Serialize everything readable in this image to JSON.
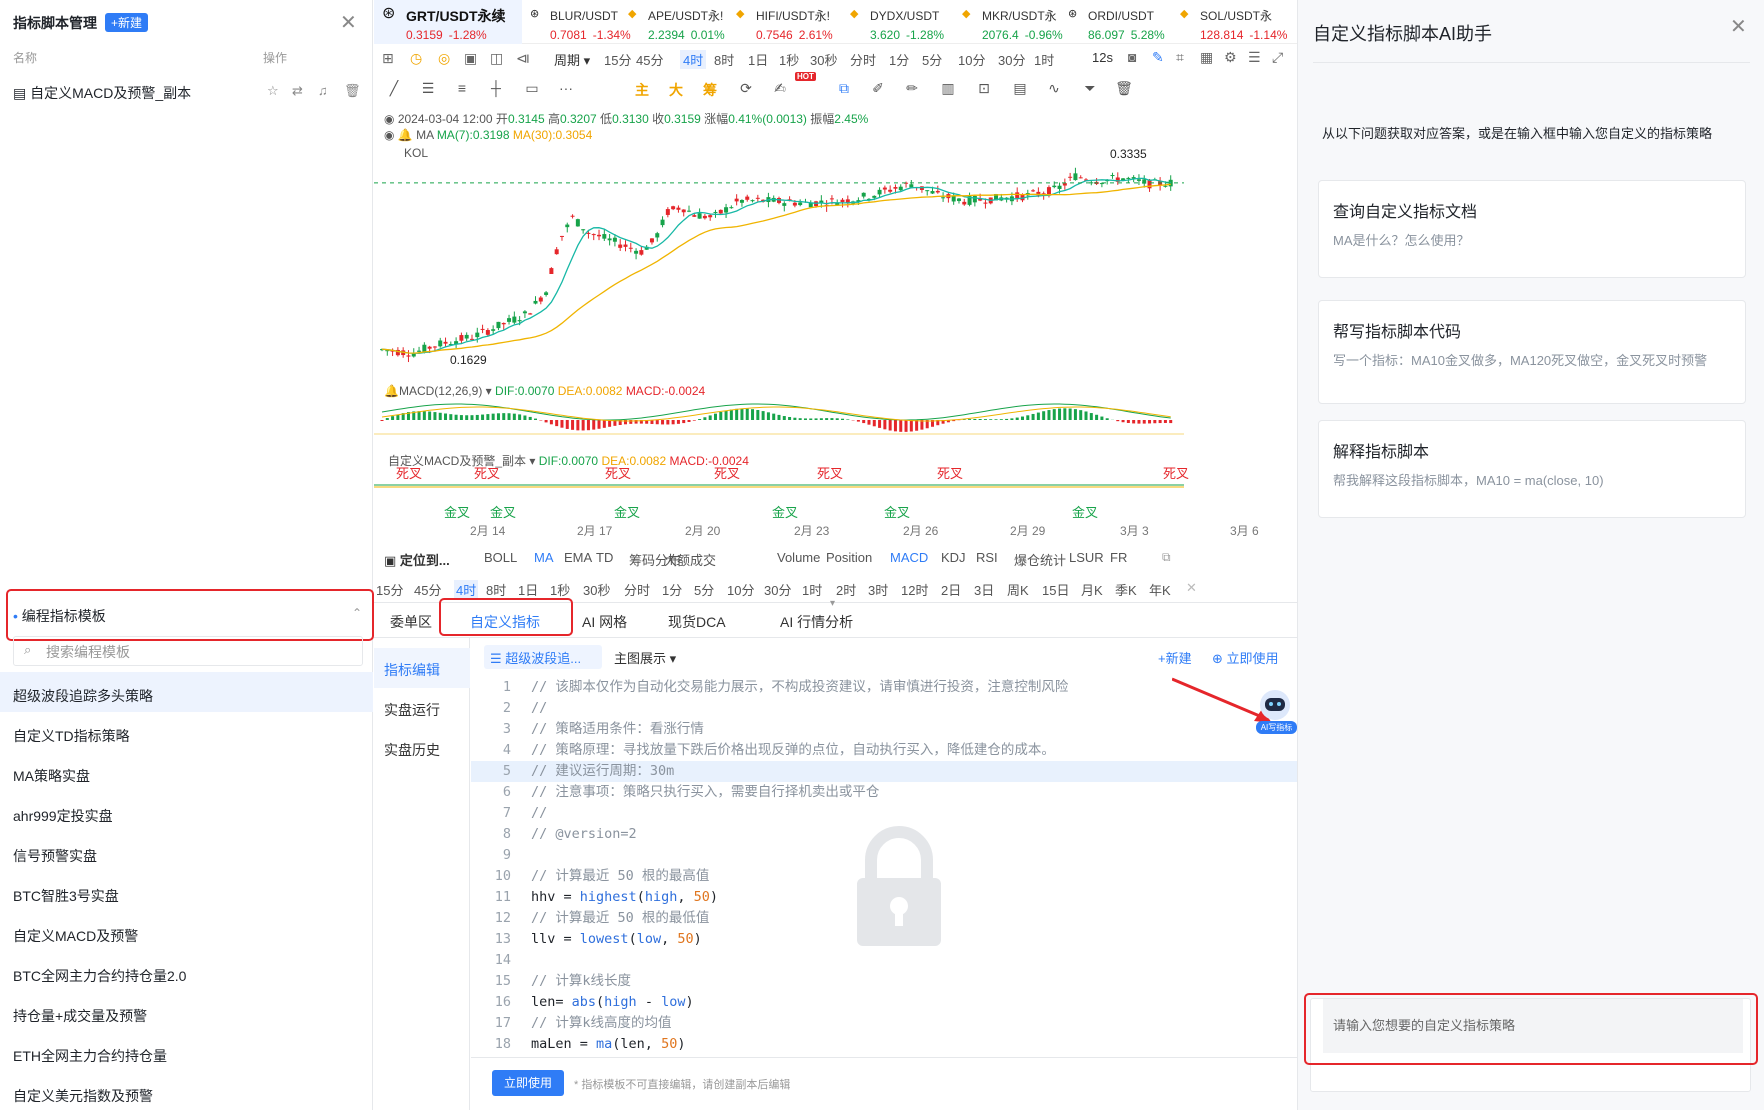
{
  "left": {
    "title": "指标脚本管理",
    "new_btn": "+新建",
    "col_name": "名称",
    "col_ops": "操作",
    "my_item": "自定义MACD及预警_副本",
    "tpl_section": "编程指标模板",
    "search_placeholder": "搜索编程模板",
    "templates": [
      "超级波段追踪多头策略",
      "自定义TD指标策略",
      "MA策略实盘",
      "ahr999定投实盘",
      "信号预警实盘",
      "BTC智胜3号实盘",
      "自定义MACD及预警",
      "BTC全网主力合约持仓量2.0",
      "持仓量+成交量及预警",
      "ETH全网主力合约持仓量",
      "自定义美元指数及预警"
    ]
  },
  "symbols": [
    {
      "name": "GRT/USDT永续",
      "price": "0.3159",
      "chg": "-1.28%",
      "dir": "down"
    },
    {
      "name": "BLUR/USDT",
      "price": "0.7081",
      "chg": "-1.34%",
      "dir": "down"
    },
    {
      "name": "APE/USDT永!",
      "price": "2.2394",
      "chg": "0.01%",
      "dir": "up"
    },
    {
      "name": "HIFI/USDT永!",
      "price": "0.7546",
      "chg": "2.61%",
      "dir": "down"
    },
    {
      "name": "DYDX/USDT",
      "price": "3.620",
      "chg": "-1.28%",
      "dir": "up"
    },
    {
      "name": "MKR/USDT永",
      "price": "2076.4",
      "chg": "-0.96%",
      "dir": "up"
    },
    {
      "name": "ORDI/USDT",
      "price": "86.097",
      "chg": "5.28%",
      "dir": "up"
    },
    {
      "name": "SOL/USDT永",
      "price": "128.814",
      "chg": "-1.14%",
      "dir": "down"
    }
  ],
  "toolbar": {
    "period_label": "周期",
    "timeframes": [
      "15分",
      "45分",
      "4时",
      "8时",
      "1日",
      "1秒",
      "30秒",
      "分时",
      "1分",
      "5分",
      "10分",
      "30分",
      "1时"
    ],
    "active_tf": "4时",
    "right_label": "12s",
    "draw_labels": [
      "主",
      "大",
      "筹"
    ],
    "hot": "HOT"
  },
  "chart": {
    "ohlc_line": "2024-03-04 12:00",
    "open_l": "开",
    "open": "0.3145",
    "high_l": "高",
    "high": "0.3207",
    "low_l": "低",
    "low": "0.3130",
    "close_l": "收",
    "close": "0.3159",
    "chg_l": "涨幅",
    "chg": "0.41%(0.0013)",
    "amp_l": "振幅",
    "amp": "2.45%",
    "ma_label": "MA",
    "ma7": "MA(7):0.3198",
    "ma30": "MA(30):0.3054",
    "kol": "KOL",
    "hi_label": "0.3335",
    "lo_label": "0.1629",
    "macd_title": "MACD(12,26,9)",
    "dif": "DIF:0.0070",
    "dea": "DEA:0.0082",
    "macd": "MACD:-0.0024",
    "custom_title": "自定义MACD及预警_副本",
    "dead": "死叉",
    "golden": "金叉",
    "dates": [
      "2月 14",
      "2月 17",
      "2月 20",
      "2月 23",
      "2月 26",
      "2月 29",
      "3月 3",
      "3月 6"
    ]
  },
  "chart_data": {
    "type": "line",
    "title": "",
    "x": [
      "2月 14",
      "2月 17",
      "2月 20",
      "2月 23",
      "2月 26",
      "2月 29",
      "3月 3",
      "3月 6"
    ],
    "series": [
      {
        "name": "MA(7)",
        "values": [
          0.168,
          0.19,
          0.26,
          0.27,
          0.29,
          0.295,
          0.31,
          0.316
        ]
      },
      {
        "name": "MA(30)",
        "values": [
          0.165,
          0.172,
          0.21,
          0.235,
          0.265,
          0.282,
          0.298,
          0.305
        ]
      }
    ],
    "annotations": [
      "0.3335",
      "0.1629"
    ]
  },
  "indicators": {
    "locate": "定位到...",
    "items": [
      "BOLL",
      "MA",
      "EMA",
      "TD",
      "筹码分布",
      "大额成交",
      "Volume",
      "Position",
      "MACD",
      "KDJ",
      "RSI",
      "爆仓统计",
      "LSUR",
      "FR"
    ],
    "active": [
      "MA",
      "MACD"
    ],
    "tfs2": [
      "15分",
      "45分",
      "4时",
      "8时",
      "1日",
      "1秒",
      "30秒",
      "分时",
      "1分",
      "5分",
      "10分",
      "30分",
      "1时",
      "2时",
      "3时",
      "12时",
      "2日",
      "3日",
      "周K",
      "15日",
      "月K",
      "季K",
      "年K"
    ]
  },
  "bottom_tabs": [
    "委单区",
    "自定义指标",
    "AI 网格",
    "现货DCA",
    "AI 行情分析"
  ],
  "side_tabs": [
    "指标编辑",
    "实盘运行",
    "实盘历史"
  ],
  "editor": {
    "script_name": "超级波段追...",
    "display_mode": "主图展示",
    "new": "+新建",
    "use_now": "立即使用",
    "ai_badge": "AI写指标",
    "lines": [
      "// 该脚本仅作为自动化交易能力展示，不构成投资建议，请审慎进行投资，注意控制风险",
      "//",
      "// 策略适用条件：看涨行情",
      "// 策略原理：寻找放量下跌后价格出现反弹的点位，自动执行买入，降低建仓的成本。",
      "// 建议运行周期：30m",
      "// 注意事项：策略只执行买入，需要自行择机卖出或平仓",
      "//",
      "// @version=2",
      "",
      "// 计算最近 50 根的最高值",
      "hhv = highest(high, 50)",
      "// 计算最近 50 根的最低值",
      "llv = lowest(low, 50)",
      "",
      "// 计算k线长度",
      "len= abs(high - low)",
      "// 计算k线高度的均值",
      "maLen = ma(len, 50)"
    ],
    "bottom_btn": "立即使用",
    "bottom_note": "* 指标模板不可直接编辑，请创建副本后编辑"
  },
  "ai": {
    "title": "自定义指标脚本AI助手",
    "intro": "从以下问题获取对应答案，或是在输入框中输入您自定义的指标策略",
    "cards": [
      {
        "title": "查询自定义指标文档",
        "desc": "MA是什么？怎么使用？"
      },
      {
        "title": "帮写指标脚本代码",
        "desc": "写一个指标：MA10金叉做多，MA120死叉做空，金叉死叉时预警"
      },
      {
        "title": "解释指标脚本",
        "desc": "帮我解释这段指标脚本，MA10 = ma(close, 10)"
      }
    ],
    "input_placeholder": "请输入您想要的自定义指标策略"
  },
  "colors": {
    "accent": "#2f7cf6",
    "up": "#17a34a",
    "down": "#e5262b",
    "highlight": "#e5262b"
  }
}
